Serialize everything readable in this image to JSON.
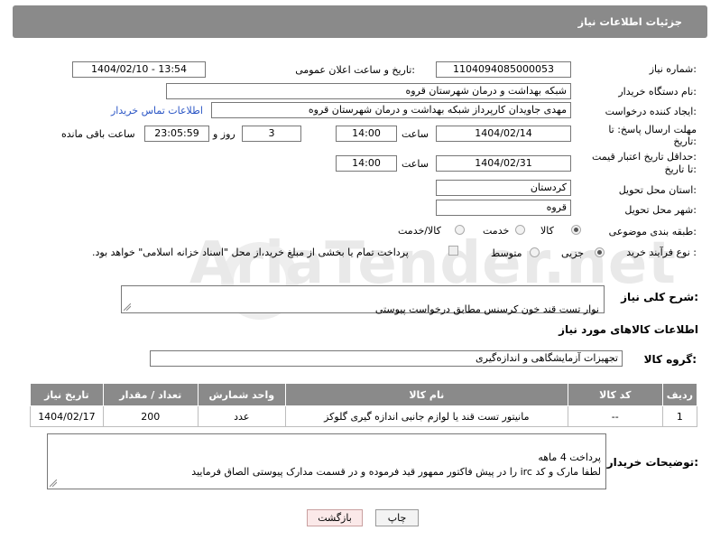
{
  "header": {
    "title": "جزئیات اطلاعات نیاز"
  },
  "watermark": "AriaTender.net",
  "form": {
    "need_number_label": "شماره نیاز:",
    "need_number": "1104094085000053",
    "announce_label": "تاریخ و ساعت اعلان عمومی:",
    "announce_value": "1404/02/10 - 13:54",
    "buyer_org_label": "نام دستگاه خریدار:",
    "buyer_org": "شبکه بهداشت و درمان شهرستان قروه",
    "creator_label": "ایجاد کننده درخواست:",
    "creator": "مهدی جاویدان کارپرداز شبکه بهداشت و درمان شهرستان قروه",
    "contact_link": "اطلاعات تماس خریدار",
    "deadline_label_1": "مهلت ارسال پاسخ: تا",
    "deadline_label_2": "تاریخ:",
    "deadline_date": "1404/02/14",
    "time_label": "ساعت",
    "deadline_time": "14:00",
    "days_value": "3",
    "days_label": "روز و",
    "remaining_time": "23:05:59",
    "remaining_label": "ساعت باقی مانده",
    "validity_label_1": "حداقل تاریخ اعتبار قیمت:",
    "validity_label_2": "تا تاریخ:",
    "validity_date": "1404/02/31",
    "validity_time": "14:00",
    "province_label": "استان محل تحویل:",
    "province": "کردستان",
    "city_label": "شهر محل تحویل:",
    "city": "قروه",
    "category_label": "طبقه بندی موضوعی:",
    "category_options": [
      "کالا",
      "خدمت",
      "کالا/خدمت"
    ],
    "category_selected": "کالا",
    "process_label": "نوع فرآیند خرید :",
    "process_options": [
      "جزیی",
      "متوسط"
    ],
    "process_selected": "جزیی",
    "payment_note": "پرداخت تمام یا بخشی از مبلغ خرید،از محل \"اسناد خزانه اسلامی\" خواهد بود."
  },
  "description": {
    "label": "شرح کلی نیاز:",
    "value": "نوار تست قند خون کرسنس مطابق درخواست پیوستی"
  },
  "goods_info": {
    "heading": "اطلاعات کالاهای مورد نیاز",
    "group_label": "گروه کالا:",
    "group_value": "تجهیزات آزمایشگاهی و اندازه‌گیری"
  },
  "table": {
    "headers": [
      "ردیف",
      "کد کالا",
      "نام کالا",
      "واحد شمارش",
      "تعداد / مقدار",
      "تاریخ نیاز"
    ],
    "rows": [
      [
        "1",
        "--",
        "مانیتور تست قند یا لوازم جانبی اندازه گیری گلوکز",
        "عدد",
        "200",
        "1404/02/17"
      ]
    ]
  },
  "buyer_notes": {
    "label": "توضیحات خریدار:",
    "value": "پرداخت 4 ماهه\nلطفا مارک و کد irc  را در پیش فاکتور ممهور قید فرموده و در قسمت مدارک پیوستی الصاق فرمایید"
  },
  "buttons": {
    "print": "چاپ",
    "back": "بازگشت"
  }
}
